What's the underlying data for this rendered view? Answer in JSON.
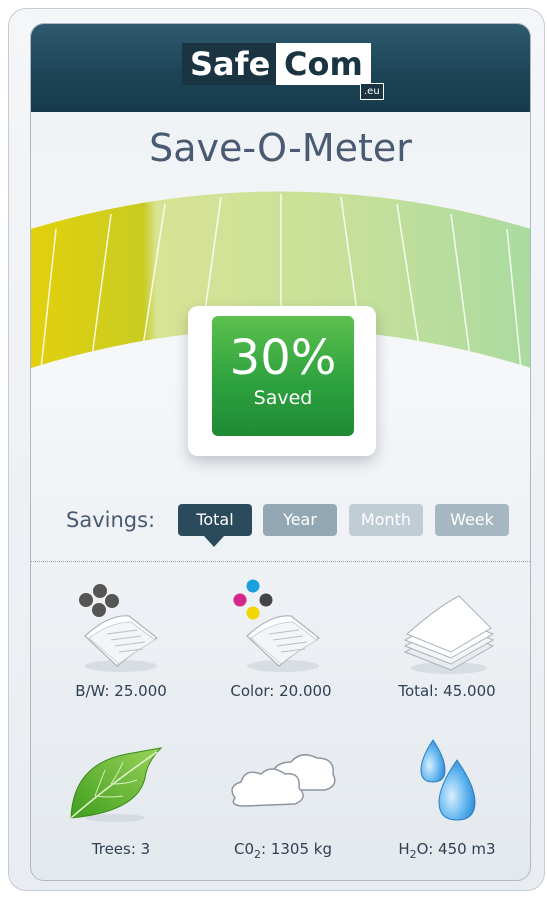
{
  "logo": {
    "part1": "Safe",
    "part2": "Com",
    "suffix": ".eu"
  },
  "title": "Save-O-Meter",
  "meter": {
    "percent_text": "30%",
    "percent": 30,
    "label": "Saved"
  },
  "savings": {
    "label": "Savings:",
    "tabs": [
      "Total",
      "Year",
      "Month",
      "Week"
    ],
    "active_tab": "Total"
  },
  "stats": {
    "bw": "B/W: 25.000",
    "color": "Color: 20.000",
    "total": "Total: 45.000",
    "trees": "Trees: 3",
    "co2_prefix": "C0",
    "co2_sub": "2",
    "co2_rest": ": 1305 kg",
    "h2o_prefix": "H",
    "h2o_sub": "2",
    "h2o_rest": "O: 450 m3"
  },
  "icons": {
    "bw": "bw-print-icon",
    "color": "color-print-icon",
    "total": "paper-stack-icon",
    "trees": "leaf-icon",
    "co2": "cloud-icon",
    "h2o": "water-drop-icon"
  },
  "colors": {
    "header": "#1d4557",
    "meter_green": "#2ea23f",
    "tab_active": "#2b4a5c",
    "gauge_start": "#f0d400",
    "gauge_end": "#9ed8a2"
  }
}
